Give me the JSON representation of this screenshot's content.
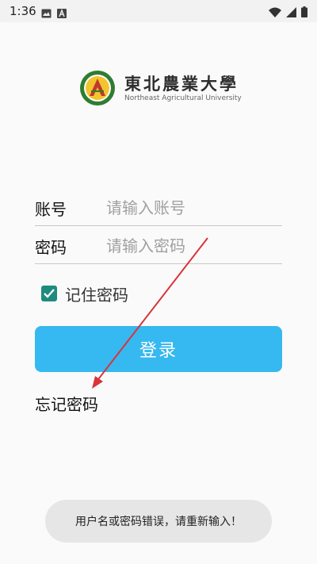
{
  "status_bar": {
    "time": "1:36",
    "icons": [
      "image-icon",
      "a-icon",
      "wifi-icon",
      "signal-icon",
      "battery-icon"
    ]
  },
  "logo": {
    "name_cn": "東北農業大學",
    "name_en": "Northeast Agricultural University"
  },
  "form": {
    "account_label": "账号",
    "account_placeholder": "请输入账号",
    "password_label": "密码",
    "password_placeholder": "请输入密码",
    "remember_label": "记住密码",
    "remember_checked": true,
    "login_button": "登录",
    "forgot_link": "忘记密码"
  },
  "toast": {
    "message": "用户名或密码错误，请重新输入！"
  },
  "colors": {
    "primary": "#36b8f0",
    "checkbox": "#1f8a7e",
    "annotation_arrow": "#d9343a"
  }
}
